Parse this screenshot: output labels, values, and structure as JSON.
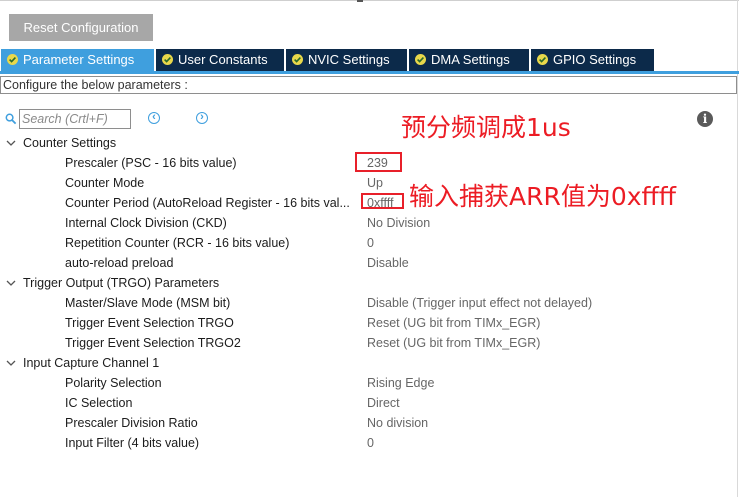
{
  "toolbar": {
    "reset_label": "Reset Configuration"
  },
  "tabs": [
    {
      "label": "Parameter Settings",
      "active": true
    },
    {
      "label": "User Constants",
      "active": false
    },
    {
      "label": "NVIC Settings",
      "active": false
    },
    {
      "label": "DMA Settings",
      "active": false
    },
    {
      "label": "GPIO Settings",
      "active": false
    }
  ],
  "configure_text": "Configure the below parameters :",
  "search": {
    "placeholder": "Search (Crtl+F)"
  },
  "groups": [
    {
      "title": "Counter Settings",
      "params": [
        {
          "name": "Prescaler (PSC - 16 bits value)",
          "value": "239"
        },
        {
          "name": "Counter Mode",
          "value": "Up"
        },
        {
          "name": "Counter Period (AutoReload Register - 16 bits val...",
          "value": "0xffff"
        },
        {
          "name": "Internal Clock Division (CKD)",
          "value": "No Division"
        },
        {
          "name": "Repetition Counter (RCR - 16 bits value)",
          "value": "0"
        },
        {
          "name": "auto-reload preload",
          "value": "Disable"
        }
      ]
    },
    {
      "title": "Trigger Output (TRGO) Parameters",
      "params": [
        {
          "name": "Master/Slave Mode (MSM bit)",
          "value": "Disable (Trigger input effect not delayed)"
        },
        {
          "name": "Trigger Event Selection TRGO",
          "value": "Reset (UG bit from TIMx_EGR)"
        },
        {
          "name": "Trigger Event Selection TRGO2",
          "value": "Reset (UG bit from TIMx_EGR)"
        }
      ]
    },
    {
      "title": "Input Capture Channel 1",
      "params": [
        {
          "name": "Polarity Selection",
          "value": "Rising Edge"
        },
        {
          "name": "IC Selection",
          "value": "Direct"
        },
        {
          "name": "Prescaler Division Ratio",
          "value": "No division"
        },
        {
          "name": "Input Filter (4 bits value)",
          "value": "0"
        }
      ]
    }
  ],
  "annotations": {
    "prescaler_note": "预分频调成1us",
    "arr_note": "输入捕获ARR值为0xffff"
  },
  "colors": {
    "tab_active": "#3f9fde",
    "tab_inactive": "#0c2a4a",
    "check_icon": "#e8d84b",
    "annotation": "#ec1c24"
  }
}
